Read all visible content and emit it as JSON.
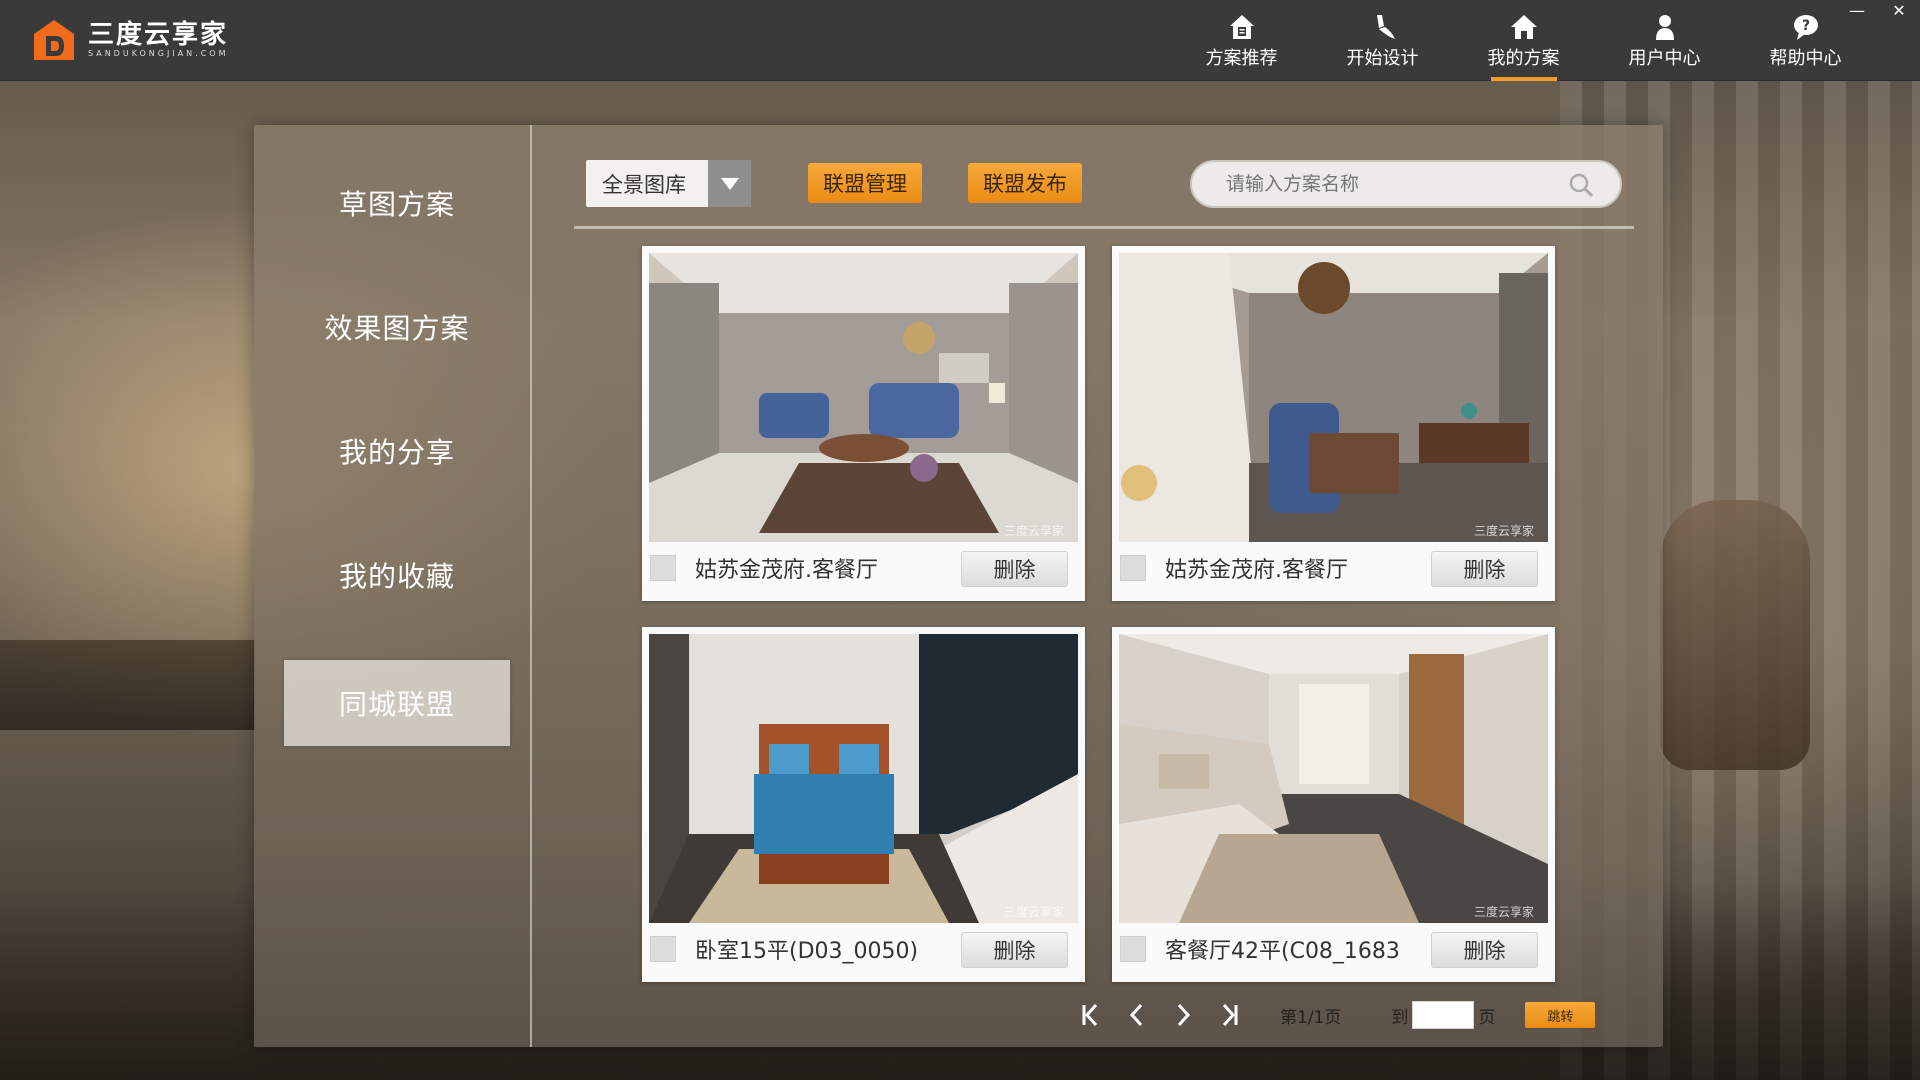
{
  "app": {
    "name": "三度云享家",
    "domain": "SANDUKONGJIAN.COM"
  },
  "nav": [
    {
      "label": "方案推荐",
      "icon": "home-doc-icon",
      "active": false
    },
    {
      "label": "开始设计",
      "icon": "brush-icon",
      "active": false
    },
    {
      "label": "我的方案",
      "icon": "home-icon",
      "active": true
    },
    {
      "label": "用户中心",
      "icon": "user-icon",
      "active": false
    },
    {
      "label": "帮助中心",
      "icon": "help-bubble-icon",
      "active": false
    }
  ],
  "window_controls": {
    "minimize": "—",
    "close": "✕"
  },
  "sidebar": {
    "items": [
      {
        "label": "草图方案",
        "active": false
      },
      {
        "label": "效果图方案",
        "active": false
      },
      {
        "label": "我的分享",
        "active": false
      },
      {
        "label": "我的收藏",
        "active": false
      },
      {
        "label": "同城联盟",
        "active": true
      }
    ]
  },
  "toolbar": {
    "dropdown_value": "全景图库",
    "alliance_manage_label": "联盟管理",
    "alliance_publish_label": "联盟发布",
    "search_placeholder": "请输入方案名称"
  },
  "cards": [
    {
      "name": "姑苏金茂府.客餐厅",
      "delete_label": "删除",
      "scene": "living-room-blue-sofas"
    },
    {
      "name": "姑苏金茂府.客餐厅",
      "delete_label": "删除",
      "scene": "living-room-chandelier"
    },
    {
      "name": "卧室15平(D03_0050)",
      "delete_label": "删除",
      "scene": "bedroom-blue-bed"
    },
    {
      "name": "客餐厅42平(C08_1683",
      "delete_label": "删除",
      "scene": "living-room-sectional"
    }
  ],
  "watermark": "三度云享家",
  "pager": {
    "page_info": "第1/1页",
    "goto_label": "到",
    "page_unit": "页",
    "jump_label": "跳转",
    "goto_value": ""
  },
  "colors": {
    "accent": "#f39c1f",
    "topbar": "#3a3a3a",
    "logo_orange": "#f26b1d"
  }
}
